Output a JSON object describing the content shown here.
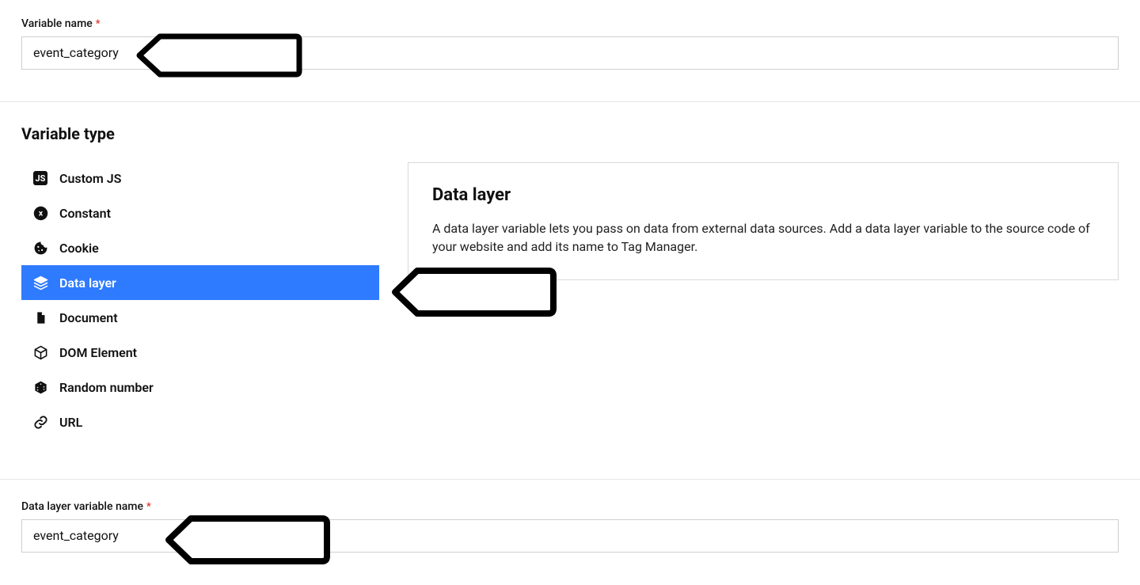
{
  "variable_name": {
    "label": "Variable name",
    "required_marker": "*",
    "value": "event_category"
  },
  "variable_type_section": {
    "title": "Variable type",
    "items": [
      {
        "id": "custom-js",
        "label": "Custom JS",
        "icon": "js-icon",
        "selected": false
      },
      {
        "id": "constant",
        "label": "Constant",
        "icon": "constant-icon",
        "selected": false
      },
      {
        "id": "cookie",
        "label": "Cookie",
        "icon": "cookie-icon",
        "selected": false
      },
      {
        "id": "data-layer",
        "label": "Data layer",
        "icon": "layers-icon",
        "selected": true
      },
      {
        "id": "document",
        "label": "Document",
        "icon": "document-icon",
        "selected": false
      },
      {
        "id": "dom-element",
        "label": "DOM Element",
        "icon": "cube-icon",
        "selected": false
      },
      {
        "id": "random-number",
        "label": "Random number",
        "icon": "dice-icon",
        "selected": false
      },
      {
        "id": "url",
        "label": "URL",
        "icon": "link-icon",
        "selected": false
      }
    ],
    "description": {
      "title": "Data layer",
      "body": "A data layer variable lets you pass on data from external data sources. Add a data layer variable to the source code of your website and add its name to Tag Manager."
    }
  },
  "data_layer_variable_name": {
    "label": "Data layer variable name",
    "required_marker": "*",
    "value": "event_category"
  }
}
